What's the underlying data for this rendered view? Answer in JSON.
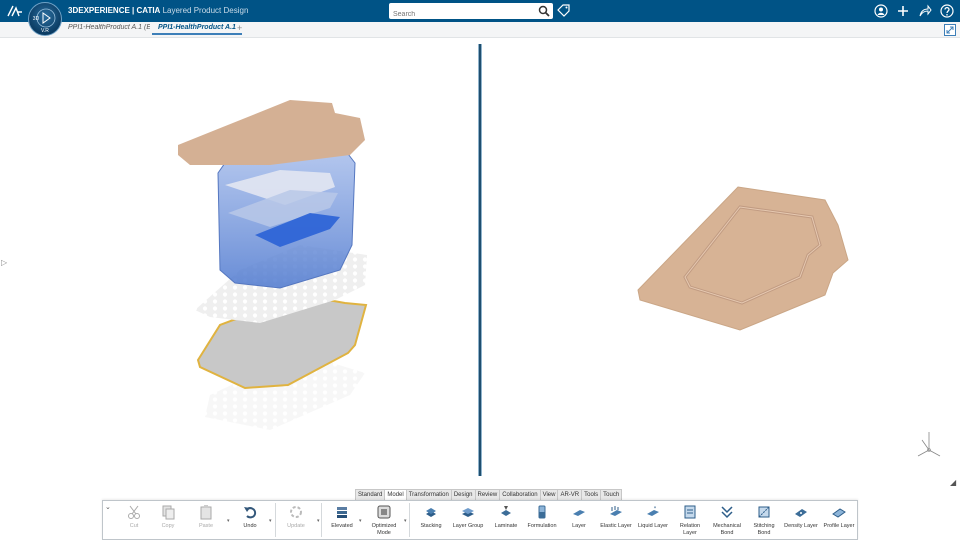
{
  "topbar": {
    "brand_bold": "3D",
    "brand_rest": "EXPERIENCE | CATIA",
    "app_name": "Layered Product Design",
    "compass_version": "V.R",
    "compass_left": "3D",
    "search_placeholder": "Search"
  },
  "tabs": [
    {
      "label": "PPI1-HealthProduct A.1 (Expl..."
    },
    {
      "label": "PPI1-HealthProduct A.1"
    }
  ],
  "tab_add": "+",
  "section_tabs": [
    "Standard",
    "Model",
    "Transformation",
    "Design",
    "Review",
    "Collaboration",
    "View",
    "AR-VR",
    "Tools",
    "Touch"
  ],
  "active_section": "Model",
  "commands": [
    {
      "label": "Cut",
      "icon": "scissors-icon",
      "disabled": true
    },
    {
      "label": "Copy",
      "icon": "copy-icon",
      "disabled": true
    },
    {
      "label": "Paste",
      "icon": "paste-icon",
      "disabled": true
    },
    {
      "label": "Undo",
      "icon": "undo-icon",
      "disabled": false
    },
    {
      "label": "Update",
      "icon": "update-icon",
      "disabled": true
    },
    {
      "label": "Elevated",
      "icon": "elevated-icon",
      "disabled": false
    },
    {
      "label": "Optimized Mode",
      "icon": "optimized-mode-icon",
      "disabled": false
    },
    {
      "label": "Stacking",
      "icon": "stacking-icon",
      "disabled": false
    },
    {
      "label": "Layer Group",
      "icon": "layer-group-icon",
      "disabled": false
    },
    {
      "label": "Laminate",
      "icon": "laminate-icon",
      "disabled": false
    },
    {
      "label": "Formulation",
      "icon": "formulation-icon",
      "disabled": false
    },
    {
      "label": "Layer",
      "icon": "layer-icon",
      "disabled": false
    },
    {
      "label": "Elastic Layer",
      "icon": "elastic-layer-icon",
      "disabled": false
    },
    {
      "label": "Liquid Layer",
      "icon": "liquid-layer-icon",
      "disabled": false
    },
    {
      "label": "Relation Layer",
      "icon": "relation-layer-icon",
      "disabled": false
    },
    {
      "label": "Mechanical Bond",
      "icon": "mechanical-bond-icon",
      "disabled": false
    },
    {
      "label": "Stitching Bond",
      "icon": "stitching-bond-icon",
      "disabled": false
    },
    {
      "label": "Density Layer",
      "icon": "density-layer-icon",
      "disabled": false
    },
    {
      "label": "Profile Layer",
      "icon": "profile-layer-icon",
      "disabled": false
    }
  ],
  "colors": {
    "topbar": "#005386",
    "skin_layer": "#d4b094",
    "blue_layer": "#6d93d6",
    "grey_layer": "#c9c9c9",
    "selection": "#e0b340"
  }
}
